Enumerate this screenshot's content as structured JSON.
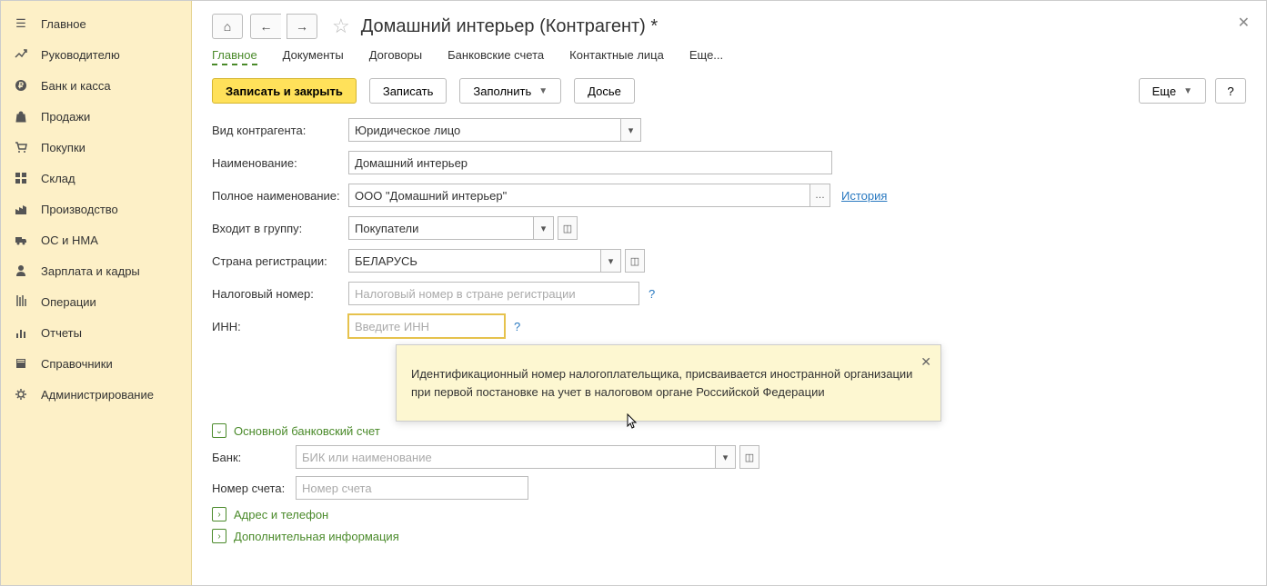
{
  "sidebar": {
    "items": [
      {
        "label": "Главное",
        "icon": "menu"
      },
      {
        "label": "Руководителю",
        "icon": "trend"
      },
      {
        "label": "Банк и касса",
        "icon": "ruble"
      },
      {
        "label": "Продажи",
        "icon": "bag"
      },
      {
        "label": "Покупки",
        "icon": "cart"
      },
      {
        "label": "Склад",
        "icon": "grid"
      },
      {
        "label": "Производство",
        "icon": "factory"
      },
      {
        "label": "ОС и НМА",
        "icon": "truck"
      },
      {
        "label": "Зарплата и кадры",
        "icon": "person"
      },
      {
        "label": "Операции",
        "icon": "ops"
      },
      {
        "label": "Отчеты",
        "icon": "bars"
      },
      {
        "label": "Справочники",
        "icon": "book"
      },
      {
        "label": "Администрирование",
        "icon": "gear"
      }
    ]
  },
  "header": {
    "title": "Домашний интерьер (Контрагент) *"
  },
  "tabs": [
    {
      "label": "Главное",
      "active": true
    },
    {
      "label": "Документы"
    },
    {
      "label": "Договоры"
    },
    {
      "label": "Банковские счета"
    },
    {
      "label": "Контактные лица"
    },
    {
      "label": "Еще..."
    }
  ],
  "toolbar": {
    "save_close": "Записать и закрыть",
    "save": "Записать",
    "fill": "Заполнить",
    "dossier": "Досье",
    "more": "Еще",
    "help": "?"
  },
  "form": {
    "type_label": "Вид контрагента:",
    "type_value": "Юридическое лицо",
    "name_label": "Наименование:",
    "name_value": "Домашний интерьер",
    "fullname_label": "Полное наименование:",
    "fullname_value": "ООО \"Домашний интерьер\"",
    "history_link": "История",
    "group_label": "Входит в группу:",
    "group_value": "Покупатели",
    "country_label": "Страна регистрации:",
    "country_value": "БЕЛАРУСЬ",
    "taxnum_label": "Налоговый номер:",
    "taxnum_placeholder": "Налоговый номер в стране регистрации",
    "inn_label": "ИНН:",
    "inn_placeholder": "Введите ИНН",
    "help_q": "?"
  },
  "tooltip": {
    "text": "Идентификационный номер налогоплательщика, присваивается иностранной организации при первой постановке на учет в налоговом органе Российской Федерации"
  },
  "bank_section": {
    "title": "Основной банковский счет",
    "bank_label": "Банк:",
    "bank_placeholder": "БИК или наименование",
    "account_label": "Номер счета:",
    "account_placeholder": "Номер счета"
  },
  "collapsed_sections": {
    "address": "Адрес и телефон",
    "extra": "Дополнительная информация"
  }
}
